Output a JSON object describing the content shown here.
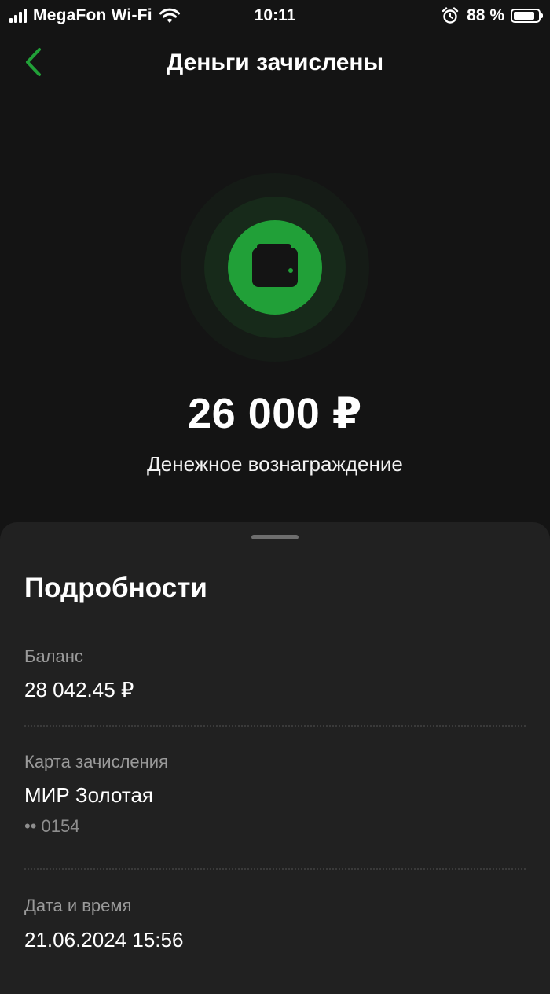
{
  "status_bar": {
    "carrier": "MegaFon Wi-Fi",
    "time": "10:11",
    "battery_percent": "88 %",
    "battery_level": 0.88,
    "icons": [
      "signal-icon",
      "wifi-icon",
      "alarm-icon",
      "battery-icon"
    ]
  },
  "header": {
    "title": "Деньги зачислены",
    "back_icon": "chevron-left-icon"
  },
  "hero": {
    "icon": "wallet-icon",
    "amount": "26 000 ₽",
    "label": "Денежное вознаграждение"
  },
  "details": {
    "title": "Подробности",
    "balance": {
      "label": "Баланс",
      "value": "28 042.45 ₽"
    },
    "card": {
      "label": "Карта зачисления",
      "value": "МИР Золотая",
      "number": "•• 0154"
    },
    "datetime": {
      "label": "Дата и время",
      "value": "21.06.2024 15:56"
    }
  },
  "colors": {
    "background": "#141414",
    "sheet": "#212121",
    "accent_green": "#21a038",
    "muted_text": "#9a9a9a"
  }
}
